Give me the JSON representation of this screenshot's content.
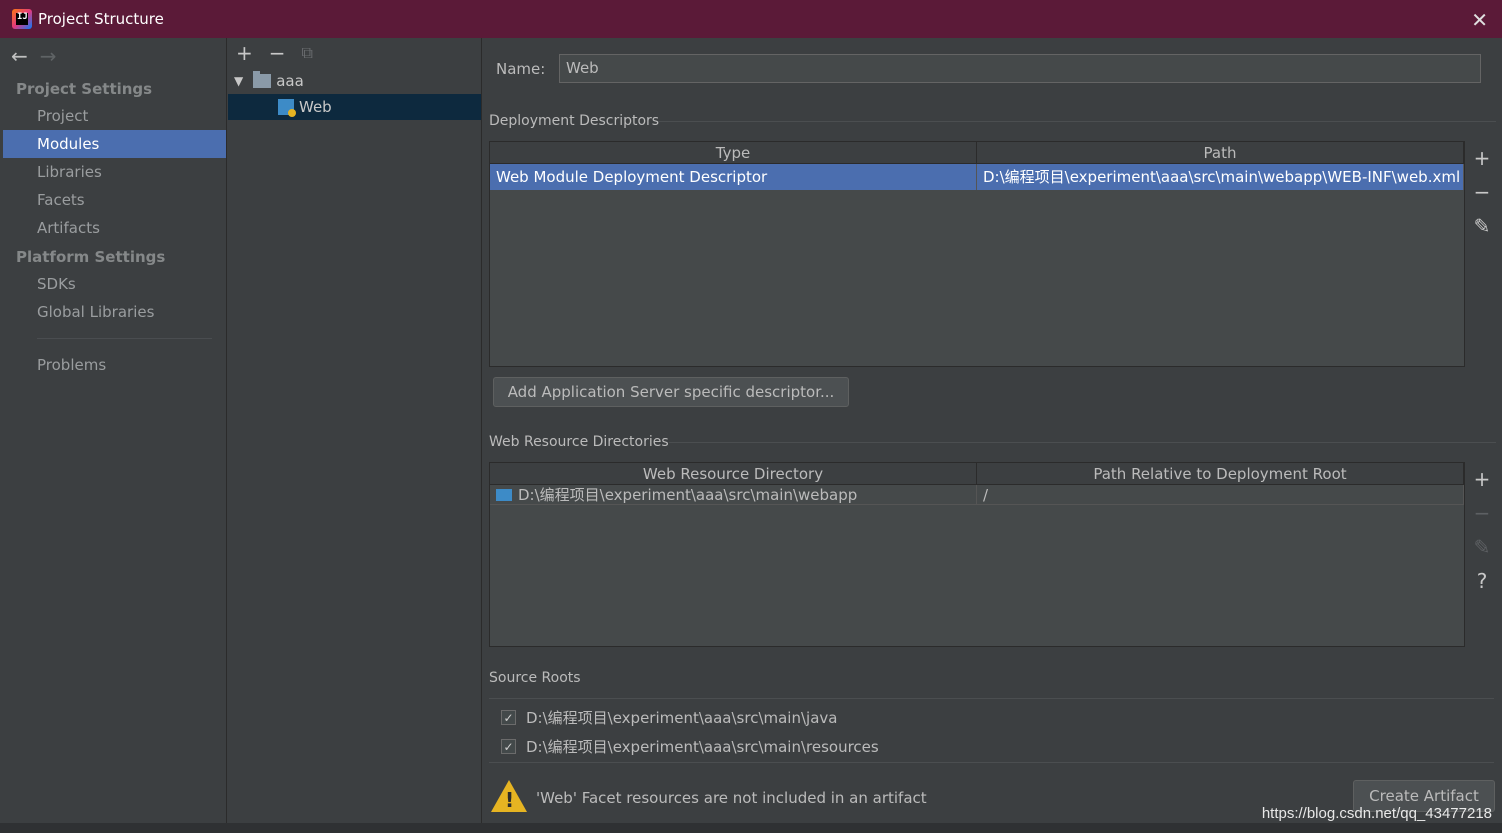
{
  "window": {
    "title": "Project Structure",
    "close_glyph": "✕",
    "icon_text": "IJ"
  },
  "nav": {
    "back_glyph": "←",
    "forward_glyph": "→",
    "project_settings_title": "Project Settings",
    "project_settings_items": [
      "Project",
      "Modules",
      "Libraries",
      "Facets",
      "Artifacts"
    ],
    "platform_settings_title": "Platform Settings",
    "platform_settings_items": [
      "SDKs",
      "Global Libraries"
    ],
    "problems": "Problems",
    "selected": "Modules"
  },
  "tree": {
    "toolbar": {
      "add": "+",
      "remove": "−",
      "copy": "⧉"
    },
    "expand_glyph": "▼",
    "root": "aaa",
    "child": "Web"
  },
  "main": {
    "name_label": "Name:",
    "name_value": "Web",
    "deployment": {
      "title": "Deployment Descriptors",
      "columns": [
        "Type",
        "Path"
      ],
      "rows": [
        {
          "type": "Web Module Deployment Descriptor",
          "path": "D:\\编程项目\\experiment\\aaa\\src\\main\\webapp\\WEB-INF\\web.xml"
        }
      ],
      "tools": {
        "add": "+",
        "remove": "−",
        "edit": "✎"
      },
      "add_server_button": "Add Application Server specific descriptor..."
    },
    "web_resources": {
      "title": "Web Resource Directories",
      "columns": [
        "Web Resource Directory",
        "Path Relative to Deployment Root"
      ],
      "rows": [
        {
          "directory": "D:\\编程项目\\experiment\\aaa\\src\\main\\webapp",
          "relative": "/"
        }
      ],
      "tools": {
        "add": "+",
        "remove": "−",
        "edit": "✎",
        "help": "?"
      }
    },
    "source_roots": {
      "title": "Source Roots",
      "items": [
        {
          "path": "D:\\编程项目\\experiment\\aaa\\src\\main\\java",
          "checked": true
        },
        {
          "path": "D:\\编程项目\\experiment\\aaa\\src\\main\\resources",
          "checked": true
        }
      ],
      "check_glyph": "✓"
    },
    "warning": {
      "text": "'Web' Facet resources are not included in an artifact",
      "glyph": "!",
      "button": "Create Artifact"
    },
    "watermark": "https://blog.csdn.net/qq_43477218"
  },
  "colors": {
    "titlebar": "#5b1a38",
    "panel": "#3c3f41",
    "selection": "#4b6eaf",
    "tree_selection": "#0d293e",
    "warning": "#e6b422"
  }
}
